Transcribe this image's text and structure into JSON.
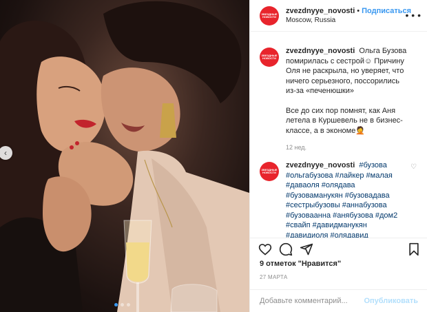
{
  "post": {
    "author": {
      "username": "zvezdnyye_novosti",
      "follow_label": "Подписаться",
      "location": "Moscow, Russia",
      "avatar_text": "ЗВЕЗДНЫЕ НОВОСТИ",
      "avatar_color": "#e8242c"
    },
    "caption": {
      "username": "zvezdnyye_novosti",
      "paragraph1": "Ольга Бузова помирилась с сестрой☺ Причину Оля не раскрыла, но уверяет, что ничего серьезного, поссорились из-за «печенюшки»",
      "paragraph2": "Все до сих пор помнят, как Аня летела в Куршевель не в бизнес-классе, а в экономе🤦",
      "time": "12 нед."
    },
    "comment": {
      "username": "zvezdnyye_novosti",
      "text": "#бузова #ольгабузова #лайкер #малая #даваоля #олядава #бузоваманукян #бузовадава #сестрыбузовы #аннабузова #бузовaанна #анябузова #дом2 #свайп #давидманукян #давидиоля #олядавид"
    },
    "likes": "9 отметок \"Нравится\"",
    "date": "27 МАРТА",
    "add_comment": {
      "placeholder": "Добавьте комментарий...",
      "publish_label": "Опубликовать"
    },
    "carousel": {
      "slides": 3,
      "active": 1
    }
  },
  "icons": {
    "more": "more-horizontal-icon",
    "like": "heart-icon",
    "comment": "comment-icon",
    "share": "share-icon",
    "save": "bookmark-icon",
    "prev": "chevron-left-icon"
  },
  "colors": {
    "link": "#3897f0",
    "hashtag": "#00376b",
    "muted": "#8e8e8e"
  }
}
